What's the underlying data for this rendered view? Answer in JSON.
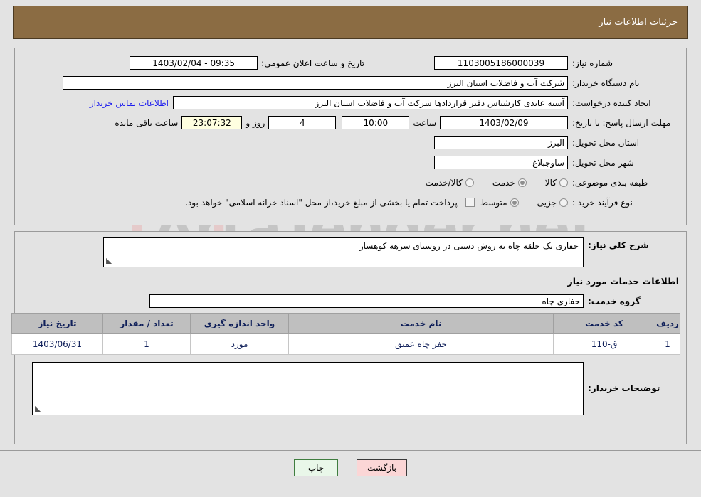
{
  "header": {
    "title": "جزئیات اطلاعات نیاز"
  },
  "colors": {
    "header_bg": "#8b6c43",
    "page_bg": "#e3e3e3",
    "link": "#1a1aee",
    "table_header_bg": "#bfbfbf",
    "table_text": "#10205a",
    "timer_bg": "#ffffe0",
    "print_button_bg": "#e9f7e9",
    "back_button_bg": "#fbd6d6"
  },
  "watermark": {
    "text": "ArtaTender.net"
  },
  "form": {
    "need_number": {
      "label": "شماره نیاز:",
      "value": "1103005186000039"
    },
    "announce_datetime": {
      "label": "تاریخ و ساعت اعلان عمومی:",
      "value": "09:35 - 1403/02/04"
    },
    "buyer_org": {
      "label": "نام دستگاه خریدار:",
      "value": "شرکت آب و فاضلاب استان البرز"
    },
    "requester": {
      "label": "ایجاد کننده درخواست:",
      "value": "آسیه عابدی کارشناس دفتر قراردادها شرکت آب و فاضلاب استان البرز",
      "contact_link": "اطلاعات تماس خریدار"
    },
    "deadline": {
      "label": "مهلت ارسال پاسخ: تا تاریخ:",
      "date": "1403/02/09",
      "time_label": "ساعت",
      "time": "10:00",
      "days": "4",
      "days_label": "روز و",
      "remaining": "23:07:32",
      "remaining_label": "ساعت باقی مانده"
    },
    "delivery_province": {
      "label": "استان محل تحویل:",
      "value": "البرز"
    },
    "delivery_city": {
      "label": "شهر محل تحویل:",
      "value": "ساوجبلاغ"
    },
    "subject_category": {
      "label": "طبقه بندی موضوعی:",
      "options": [
        "کالا",
        "خدمت",
        "کالا/خدمت"
      ],
      "selected": "خدمت"
    },
    "purchase_process": {
      "label": "نوع فرآیند خرید :",
      "options": [
        "جزیی",
        "متوسط"
      ],
      "selected": "متوسط",
      "treasury_checkbox_checked": false,
      "treasury_note": "پرداخت تمام یا بخشی از مبلغ خرید،از محل \"اسناد خزانه اسلامی\" خواهد بود."
    }
  },
  "need_summary": {
    "label": "شرح کلی نیاز:",
    "value": "حفاری یک حلقه چاه به روش دستی در روستای سرهه کوهسار"
  },
  "services_section": {
    "title": "اطلاعات خدمات مورد نیاز",
    "service_group": {
      "label": "گروه خدمت:",
      "value": "حفاری چاه"
    },
    "table": {
      "columns": [
        "ردیف",
        "کد خدمت",
        "نام خدمت",
        "واحد اندازه گیری",
        "تعداد / مقدار",
        "تاریخ نیاز"
      ],
      "rows": [
        {
          "row": "1",
          "service_code": "ق-110",
          "service_name": "حفر چاه عمیق",
          "unit": "مورد",
          "quantity": "1",
          "need_date": "1403/06/31"
        }
      ]
    }
  },
  "buyer_notes": {
    "label": "توضیحات خریدار:",
    "value": ""
  },
  "footer": {
    "print_label": "چاپ",
    "back_label": "بازگشت"
  }
}
